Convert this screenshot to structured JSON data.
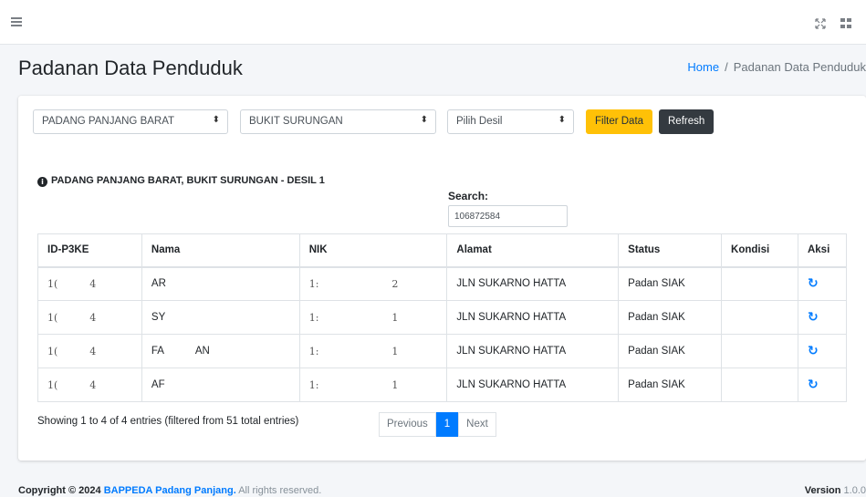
{
  "header": {
    "icons": [
      "menu-icon",
      "fullscreen-icon",
      "apps-grid-icon"
    ]
  },
  "page": {
    "title": "Padanan Data Penduduk"
  },
  "breadcrumb": {
    "home": "Home",
    "separator": "/",
    "current": "Padanan Data Penduduk"
  },
  "filters": {
    "kecamatan": "PADANG PANJANG BARAT",
    "kelurahan": "BUKIT SURUNGAN",
    "desil": "Pilih Desil",
    "filter_button": "Filter Data",
    "refresh_button": "Refresh"
  },
  "filter_heading": "PADANG PANJANG BARAT, BUKIT SURUNGAN - DESIL 1",
  "search": {
    "label": "Search:",
    "value": "106872584"
  },
  "table": {
    "headers": [
      "ID-P3KE",
      "Nama",
      "NIK",
      "Alamat",
      "Status",
      "Kondisi",
      "Aksi"
    ],
    "rows": [
      {
        "id": "1(          4",
        "nama": "AR",
        "nik": "1:",
        "nik_end": "2",
        "alamat": "JLN SUKARNO HATTA",
        "status": "Padan SIAK",
        "kondisi": ""
      },
      {
        "id": "1(          4",
        "nama": "SY",
        "nik": "1:",
        "nik_end": "1",
        "alamat": "JLN SUKARNO HATTA",
        "status": "Padan SIAK",
        "kondisi": ""
      },
      {
        "id": "1(          4",
        "nama": "FA           AN",
        "nik": "1:",
        "nik_end": "1",
        "alamat": "JLN SUKARNO HATTA",
        "status": "Padan SIAK",
        "kondisi": ""
      },
      {
        "id": "1(          4",
        "nama": "AF",
        "nik": "1:",
        "nik_end": "1",
        "alamat": "JLN SUKARNO HATTA",
        "status": "Padan SIAK",
        "kondisi": ""
      }
    ]
  },
  "info": "Showing 1 to 4 of 4 entries (filtered from 51 total entries)",
  "pagination": {
    "previous": "Previous",
    "current": "1",
    "next": "Next"
  },
  "footer": {
    "copyright_prefix": "Copyright © 2024",
    "org": "BAPPEDA Padang Panjang.",
    "rights": "All rights reserved.",
    "version_label": "Version",
    "version": "1.0.0"
  },
  "colors": {
    "primary": "#007bff",
    "warning": "#ffc107",
    "dark": "#343a40",
    "background": "#f4f6f9"
  }
}
